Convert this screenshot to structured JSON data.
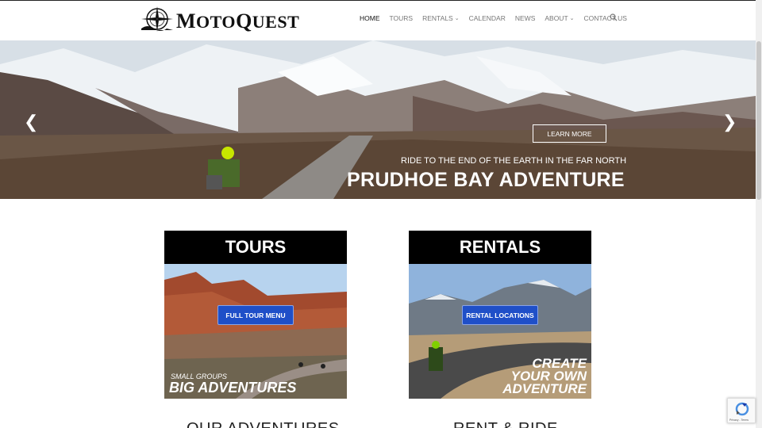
{
  "header": {
    "logo_text_first": "M",
    "logo_text_rest": "OTO",
    "logo_text_q": "Q",
    "logo_text_end": "UEST",
    "logo_alt": "MotoQuest"
  },
  "nav": {
    "items": [
      {
        "label": "HOME",
        "active": true,
        "dropdown": false
      },
      {
        "label": "TOURS",
        "active": false,
        "dropdown": false
      },
      {
        "label": "RENTALS",
        "active": false,
        "dropdown": true
      },
      {
        "label": "CALENDAR",
        "active": false,
        "dropdown": false
      },
      {
        "label": "NEWS",
        "active": false,
        "dropdown": false
      },
      {
        "label": "ABOUT",
        "active": false,
        "dropdown": true
      },
      {
        "label": "CONTACT US",
        "active": false,
        "dropdown": false
      }
    ],
    "search_icon": "search-icon"
  },
  "hero": {
    "button_label": "LEARN MORE",
    "subtitle": "RIDE TO THE END OF THE EARTH IN THE FAR NORTH",
    "title": "PRUDHOE BAY ADVENTURE",
    "prev_icon": "chevron-left-icon",
    "next_icon": "chevron-right-icon"
  },
  "cards": {
    "tours": {
      "title": "TOURS",
      "button_label": "FULL TOUR MENU",
      "overlay_small": "SMALL GROUPS",
      "overlay_big": "BIG ADVENTURES"
    },
    "rentals": {
      "title": "RENTALS",
      "button_label": "RENTAL LOCATIONS",
      "overlay_line1": "CREATE",
      "overlay_line2": "YOUR OWN",
      "overlay_line3": "ADVENTURE"
    }
  },
  "sections": {
    "adventures_heading": "OUR ADVENTURES",
    "rent_ride_heading": "RENT & RIDE"
  },
  "recaptcha": {
    "label": "Privacy - Terms"
  },
  "colors": {
    "button_blue": "#1f4fc8",
    "card_header": "#000000",
    "nav_text": "#777777",
    "nav_active": "#111111"
  }
}
